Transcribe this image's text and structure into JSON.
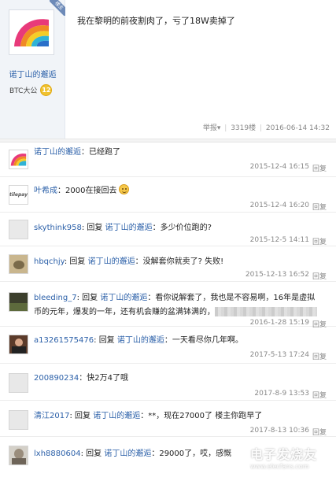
{
  "post": {
    "author": "诺丁山的邂逅",
    "ribbon": "楼主",
    "group": "BTC大公",
    "level": "12",
    "content": "我在黎明的前夜割肉了，亏了18W卖掉了",
    "report": "举报",
    "floor": "3319楼",
    "datetime": "2016-06-14 14:32"
  },
  "reply_label": "回复",
  "comments": [
    {
      "user": "诺丁山的邂逅",
      "text": "：已经跑了",
      "time": "2015-12-4 16:15"
    },
    {
      "user": "叶希成",
      "text": "：2000在接回去",
      "time": "2015-12-4 16:20",
      "emoji": "smiley-icon"
    },
    {
      "user": "skythink958",
      "reply_word": "回复",
      "target": "诺丁山的邂逅",
      "text": "：多少价位跑的?",
      "time": "2015-12-5 14:11"
    },
    {
      "user": "hbqchjy",
      "reply_word": "回复",
      "target": "诺丁山的邂逅",
      "text": "：没解套你就卖了? 失败!",
      "time": "2015-12-13 16:52"
    },
    {
      "user": "bleeding_7",
      "reply_word": "回复",
      "target": "诺丁山的邂逅",
      "text": "：看你说解套了，我也是不容易啊，16年是虚拟",
      "text2": "币的元年，爆发的一年，还有机会赚的盆满钵满的，",
      "time": "2016-1-28 15:19"
    },
    {
      "user": "a13261575476",
      "reply_word": "回复",
      "target": "诺丁山的邂逅",
      "text": "：一天看尽你几年啊。",
      "time": "2017-5-13 17:24"
    },
    {
      "user": "200890234",
      "text": "：快2万4了哦",
      "time": "2017-8-9 13:53"
    },
    {
      "user": "清江2017",
      "reply_word": "回复",
      "target": "诺丁山的邂逅",
      "text": "：**，现在27000了 楼主你跑早了",
      "time": "2017-8-13 10:36"
    },
    {
      "user": "lxh8880604",
      "reply_word": "回复",
      "target": "诺丁山的邂逅",
      "text": "：29000了，哎，感慨"
    }
  ],
  "watermark": {
    "text": "电子发烧友",
    "url": "www.elecfans.com"
  }
}
